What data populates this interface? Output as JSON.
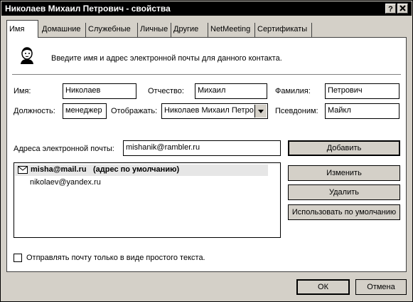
{
  "window": {
    "title": "Николаев Михаил Петрович - свойства",
    "help_btn": "?",
    "close_btn": "x"
  },
  "tabs": [
    "Имя",
    "Домашние",
    "Служебные",
    "Личные",
    "Другие",
    "NetMeeting",
    "Сертификаты"
  ],
  "intro": {
    "text": "Введите имя и адрес электронной почты для данного контакта."
  },
  "fields": {
    "first_name": {
      "label": "Имя:",
      "value": "Николаев"
    },
    "middle_name": {
      "label": "Отчество:",
      "value": "Михаил"
    },
    "last_name": {
      "label": "Фамилия:",
      "value": "Петрович"
    },
    "position": {
      "label": "Должность:",
      "value": "менеджер"
    },
    "display": {
      "label": "Отображать:",
      "value": "Николаев Михаил Петро"
    },
    "nickname": {
      "label": "Псевдоним:",
      "value": "Майкл"
    }
  },
  "email": {
    "label": "Адреса электронной почты:",
    "value": "mishanik@rambler.ru",
    "list": [
      {
        "address": "misha@mail.ru",
        "note": "(адрес по умолчанию)"
      },
      {
        "address": "nikolaev@yandex.ru"
      }
    ]
  },
  "buttons": {
    "add": "Добавить",
    "edit": "Изменить",
    "delete": "Удалить",
    "set_default": "Использовать по умолчанию",
    "ok": "ОК",
    "cancel": "Отмена"
  },
  "plain_text": {
    "label": "Отправлять почту только в виде простого текста.",
    "checked": false
  },
  "icons": {
    "contact": "contact-person-icon",
    "mail": "envelope-icon",
    "dropdown": "dropdown-arrow-icon"
  }
}
